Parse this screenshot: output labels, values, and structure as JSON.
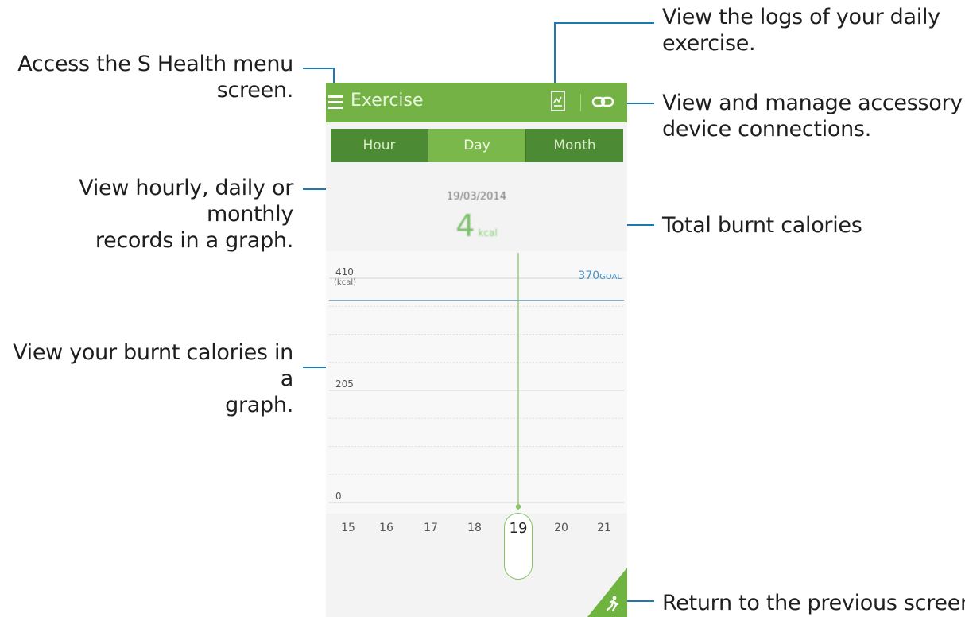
{
  "annotations": {
    "menu": [
      "Access the S Health menu",
      "screen."
    ],
    "logs": [
      "View the logs of your daily",
      "exercise."
    ],
    "accessory": [
      "View and manage accessory",
      "device connections."
    ],
    "period": [
      "View hourly, daily or monthly",
      "records in a graph."
    ],
    "calories_total": "Total burnt calories",
    "graph": [
      "View your burnt calories in a",
      "graph."
    ],
    "return": "Return to the previous screen."
  },
  "app": {
    "title": "Exercise",
    "icons": {
      "menu": "hamburger-icon",
      "logs": "log-icon",
      "accessory": "link-icon",
      "fab": "running-person-icon"
    },
    "colors": {
      "actionbar": "#74b246",
      "tab_dark": "#4c8b33",
      "tab_active": "#7ab84c",
      "callout": "#1e78b4",
      "accent_green": "#7cc06e",
      "goal_blue": "#4a90c8"
    }
  },
  "tabs": [
    {
      "label": "Hour",
      "active": false
    },
    {
      "label": "Day",
      "active": true
    },
    {
      "label": "Month",
      "active": false
    }
  ],
  "summary": {
    "date": "19/03/2014",
    "value": "4",
    "unit": "kcal"
  },
  "chart_data": {
    "type": "line",
    "y_ticks": [
      "410",
      "205",
      "0"
    ],
    "y_unit": "(kcal)",
    "ylim": [
      0,
      410
    ],
    "goal": {
      "value": "370",
      "label": "GOAL"
    },
    "categories": [
      "15",
      "16",
      "17",
      "18",
      "19",
      "20",
      "21"
    ],
    "selected": "19",
    "values": [
      null,
      null,
      null,
      null,
      4,
      null,
      null
    ]
  }
}
